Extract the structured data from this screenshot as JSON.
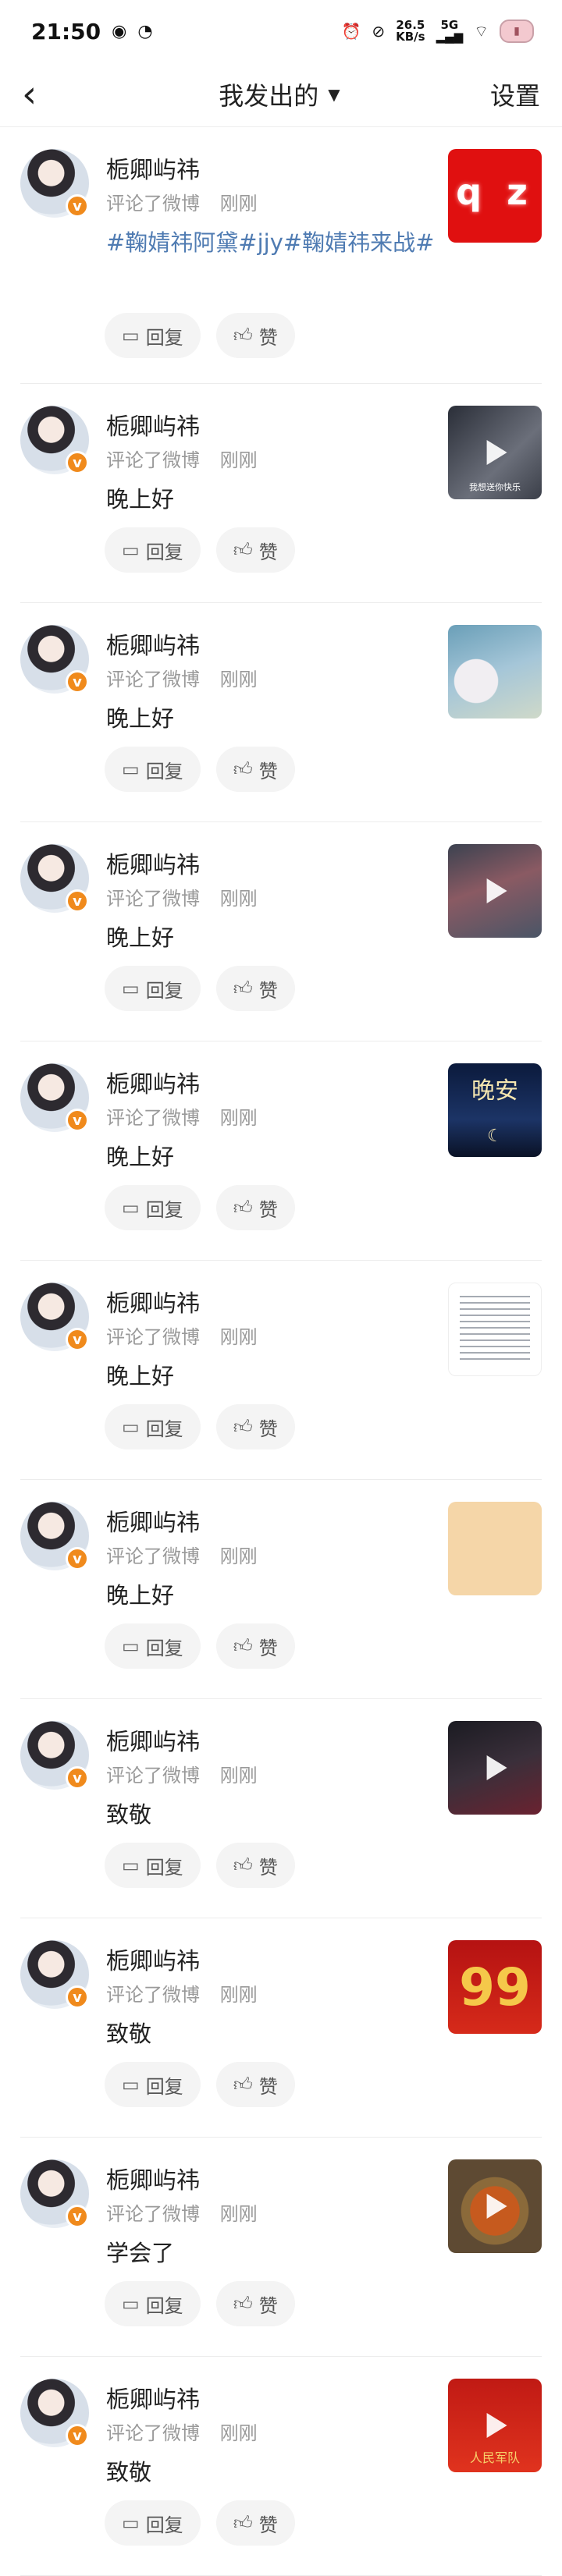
{
  "status_bar": {
    "time": "21:50",
    "speed_value": "26.5",
    "speed_unit": "KB/s",
    "network": "5G"
  },
  "nav": {
    "title": "我发出的",
    "settings": "设置"
  },
  "actions": {
    "reply": "回复",
    "like": "赞"
  },
  "icons": {
    "back": "chevron-left-icon",
    "caret": "caret-down-icon",
    "reply": "comment-icon",
    "like": "thumbs-up-icon",
    "verified": "verified-badge-icon"
  },
  "colors": {
    "topic": "#4f7bb2",
    "badge": "#f08a1c",
    "qz_bg": "#e01010"
  },
  "items": [
    {
      "user": "栀卿屿祎",
      "action": "评论了微博",
      "time": "刚刚",
      "content": "#鞠婧祎阿黛#jjy#鞠婧祎来战#",
      "thumb": "qz"
    },
    {
      "user": "栀卿屿祎",
      "action": "评论了微博",
      "time": "刚刚",
      "content": "晚上好",
      "thumb": "video-dark",
      "thumb_caption": "我想送你快乐"
    },
    {
      "user": "栀卿屿祎",
      "action": "评论了微博",
      "time": "刚刚",
      "content": "晚上好",
      "thumb": "blossom"
    },
    {
      "user": "栀卿屿祎",
      "action": "评论了微博",
      "time": "刚刚",
      "content": "晚上好",
      "thumb": "video-sky"
    },
    {
      "user": "栀卿屿祎",
      "action": "评论了微博",
      "time": "刚刚",
      "content": "晚上好",
      "thumb": "night",
      "thumb_caption": "晚安"
    },
    {
      "user": "栀卿屿祎",
      "action": "评论了微博",
      "time": "刚刚",
      "content": "晚上好",
      "thumb": "document"
    },
    {
      "user": "栀卿屿祎",
      "action": "评论了微博",
      "time": "刚刚",
      "content": "晚上好",
      "thumb": "beige"
    },
    {
      "user": "栀卿屿祎",
      "action": "评论了微博",
      "time": "刚刚",
      "content": "致敬",
      "thumb": "video-night"
    },
    {
      "user": "栀卿屿祎",
      "action": "评论了微博",
      "time": "刚刚",
      "content": "致敬",
      "thumb": "red-99",
      "thumb_caption": "99"
    },
    {
      "user": "栀卿屿祎",
      "action": "评论了微博",
      "time": "刚刚",
      "content": "学会了",
      "thumb": "video-food"
    },
    {
      "user": "栀卿屿祎",
      "action": "评论了微博",
      "time": "刚刚",
      "content": "致敬",
      "thumb": "video-red",
      "thumb_caption": "人民军队"
    }
  ]
}
